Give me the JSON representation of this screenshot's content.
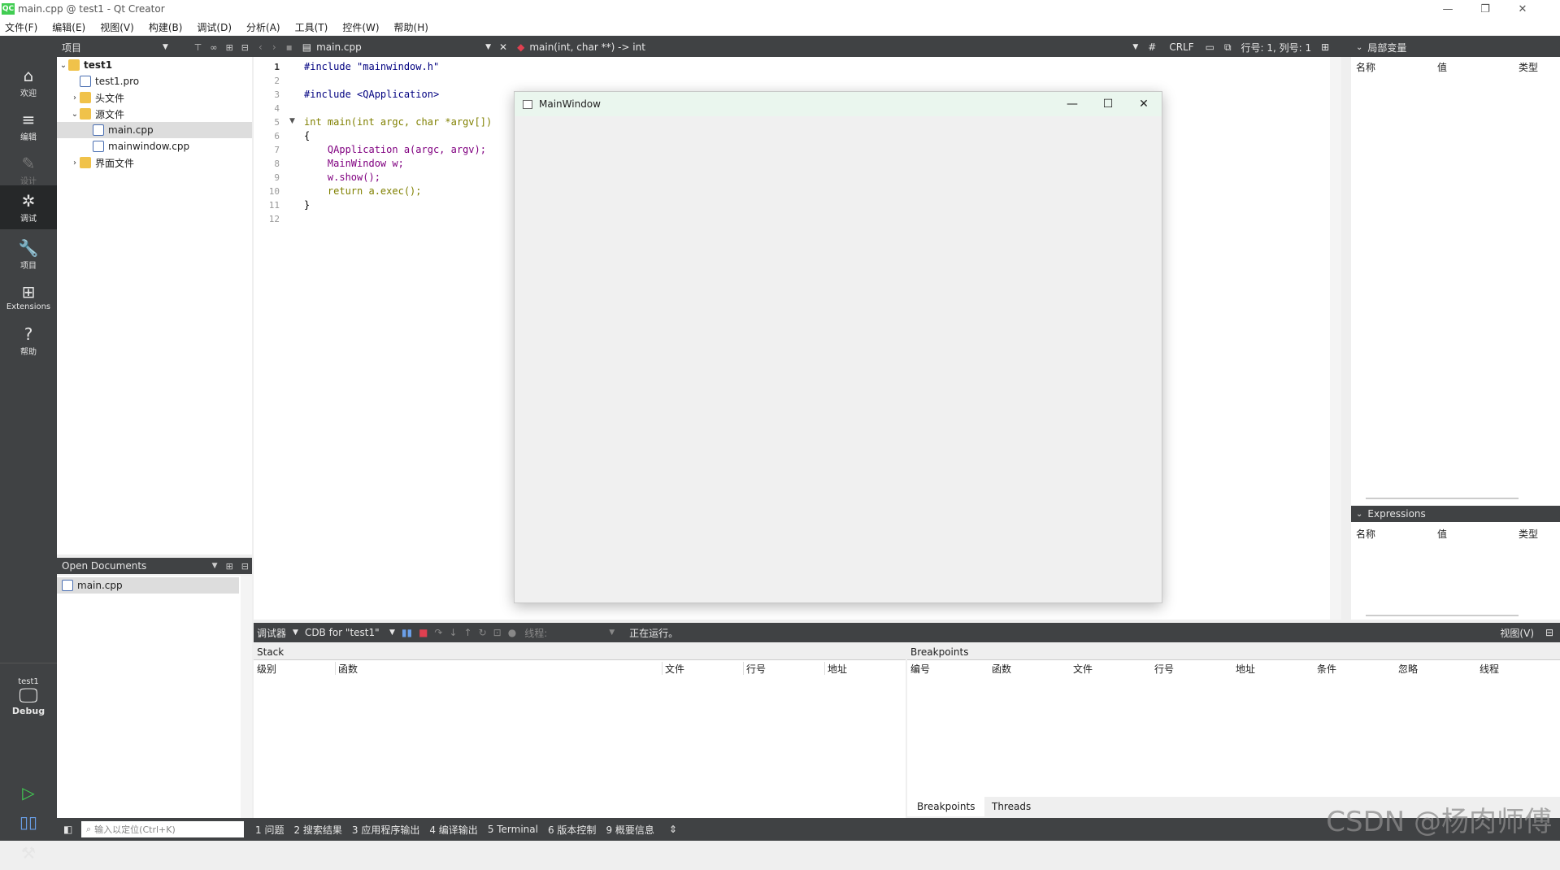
{
  "window": {
    "title": "main.cpp @ test1 - Qt Creator",
    "logo": "QC"
  },
  "menu": [
    "文件(F)",
    "编辑(E)",
    "视图(V)",
    "构建(B)",
    "调试(D)",
    "分析(A)",
    "工具(T)",
    "控件(W)",
    "帮助(H)"
  ],
  "modes": [
    {
      "icon": "⌂",
      "label": "欢迎"
    },
    {
      "icon": "≡",
      "label": "编辑"
    },
    {
      "icon": "✎",
      "label": "设计"
    },
    {
      "icon": "✲",
      "label": "调试"
    },
    {
      "icon": "🔧",
      "label": "项目"
    },
    {
      "icon": "⊞",
      "label": "Extensions"
    },
    {
      "icon": "?",
      "label": "帮助"
    }
  ],
  "kit": {
    "project": "test1",
    "config": "Debug"
  },
  "projects_panel": {
    "title": "项目",
    "tree": [
      {
        "label": "test1",
        "type": "project",
        "expanded": true
      },
      {
        "label": "test1.pro",
        "type": "file"
      },
      {
        "label": "头文件",
        "type": "folder",
        "expanded": false
      },
      {
        "label": "源文件",
        "type": "folder",
        "expanded": true
      },
      {
        "label": "main.cpp",
        "type": "file",
        "selected": true
      },
      {
        "label": "mainwindow.cpp",
        "type": "file"
      },
      {
        "label": "界面文件",
        "type": "folder",
        "expanded": false
      }
    ]
  },
  "open_documents": {
    "title": "Open Documents",
    "items": [
      "main.cpp"
    ]
  },
  "editor": {
    "file_tab": "main.cpp",
    "symbol": "main(int, char **) -> int",
    "hash": "#",
    "line_ending": "CRLF",
    "position": "行号: 1, 列号: 1",
    "lines": [
      "#include \"mainwindow.h\"",
      "",
      "#include <QApplication>",
      "",
      "int main(int argc, char *argv[])",
      "{",
      "    QApplication a(argc, argv);",
      "    MainWindow w;",
      "    w.show();",
      "    return a.exec();",
      "}",
      ""
    ],
    "line_numbers": [
      "1",
      "2",
      "3",
      "4",
      "5",
      "6",
      "7",
      "8",
      "9",
      "10",
      "11",
      "12"
    ]
  },
  "app_window": {
    "title": "MainWindow"
  },
  "locals": {
    "title": "局部变量",
    "columns": [
      "名称",
      "值",
      "类型"
    ]
  },
  "expressions": {
    "title": "Expressions",
    "columns": [
      "名称",
      "值",
      "类型"
    ]
  },
  "debug_toolbar": {
    "debugger": "调试器",
    "engine": "CDB for \"test1\"",
    "thread_placeholder": "线程:",
    "status": "正在运行。",
    "view": "视图(V)"
  },
  "stack": {
    "title": "Stack",
    "columns": [
      "级别",
      "函数",
      "文件",
      "行号",
      "地址"
    ]
  },
  "breakpoints": {
    "title": "Breakpoints",
    "columns": [
      "编号",
      "函数",
      "文件",
      "行号",
      "地址",
      "条件",
      "忽略",
      "线程"
    ],
    "tabs": [
      "Breakpoints",
      "Threads"
    ]
  },
  "statusbar": {
    "locator_placeholder": "输入以定位(Ctrl+K)",
    "tabs": [
      "1 问题",
      "2 搜索结果",
      "3 应用程序输出",
      "4 编译输出",
      "5 Terminal",
      "6 版本控制",
      "9 概要信息"
    ]
  },
  "watermark": "CSDN @杨肉师傅"
}
